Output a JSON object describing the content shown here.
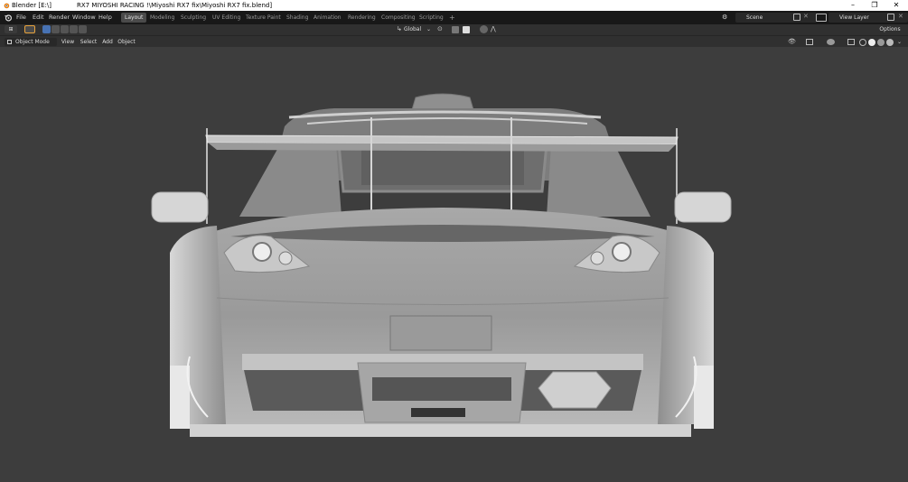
{
  "window": {
    "app": "Blender [E:\\]",
    "file": "RX7 MIYOSHI RACING !\\Miyoshi RX7 fix\\Miyoshi RX7 fix.blend]",
    "minimize": "–",
    "restore": "❐",
    "close": "✕"
  },
  "menu": [
    "File",
    "Edit",
    "Render",
    "Window",
    "Help"
  ],
  "workspaces": [
    "Layout",
    "Modeling",
    "Sculpting",
    "UV Editing",
    "Texture Paint",
    "Shading",
    "Animation",
    "Rendering",
    "Compositing",
    "Scripting"
  ],
  "add_workspace": "+",
  "scene": "Scene",
  "view_layer": "View Layer",
  "toolbar": {
    "orientation": "Global",
    "options": "Options"
  },
  "header": {
    "mode": "Object Mode",
    "view": "View",
    "select": "Select",
    "add": "Add",
    "object": "Object"
  },
  "colors": {
    "accent": "#4772b3",
    "ui_dark": "#181818",
    "header": "#303030",
    "viewport": "#3d3d3d"
  }
}
